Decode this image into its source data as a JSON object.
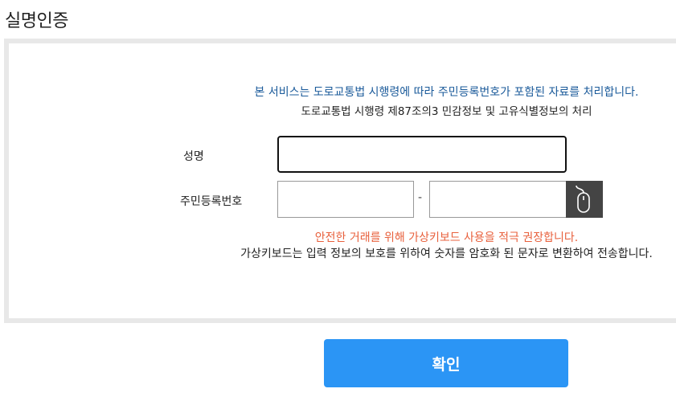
{
  "page": {
    "title": "실명인증"
  },
  "notices": {
    "line1": "본 서비스는 도로교통법 시행령에 따라 주민등록번호가 포함된 자료를 처리합니다.",
    "line2": "도로교통법 시행령 제87조의3 민감정보 및 고유식별정보의 처리"
  },
  "form": {
    "name_label": "성명",
    "name_value": "",
    "rrn_label": "주민등록번호",
    "rrn_front_value": "",
    "rrn_separator": "-",
    "rrn_back_value": "",
    "virtual_keyboard_icon": "mouse-icon"
  },
  "messages": {
    "warning": "안전한 거래를 위해 가상키보드 사용을 적극 권장합니다.",
    "warning_color": "#e8603c",
    "description": "가상키보드는 입력 정보의 보호를 위하여 숫자를 암호화 된 문자로 변환하여 전송합니다."
  },
  "actions": {
    "confirm_label": "확인",
    "confirm_color": "#2b95f5"
  }
}
